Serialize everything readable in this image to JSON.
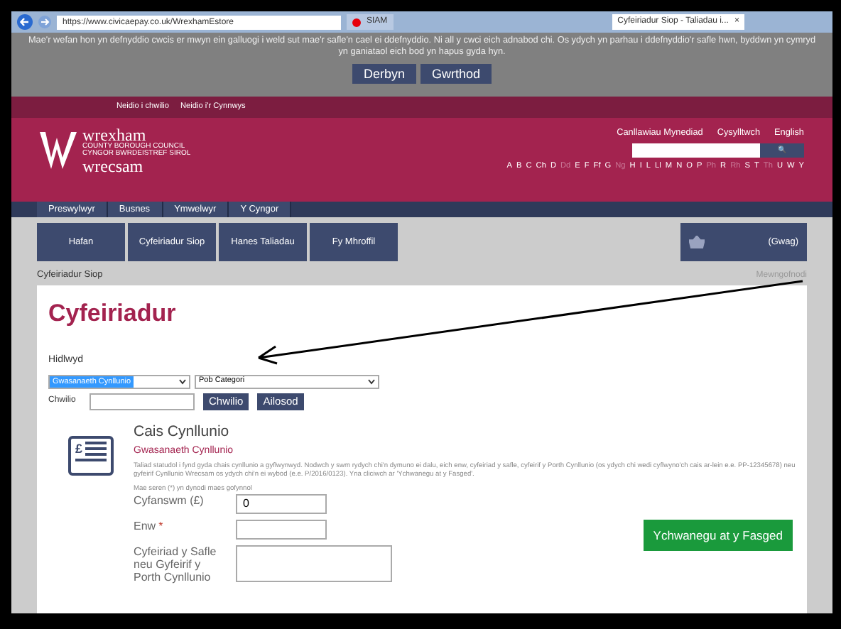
{
  "browser": {
    "url": "https://www.civicaepay.co.uk/WrexhamEstore",
    "tabs": [
      {
        "label": "SIAM",
        "selected": false
      },
      {
        "label": "Cyfeiriadur Siop - Taliadau i...",
        "selected": true
      }
    ],
    "tab_close": "×"
  },
  "cookie_banner": {
    "text": "Mae'r wefan hon yn defnyddio cwcis er mwyn ein galluogi i weld sut mae'r safle'n cael ei ddefnyddio. Ni all y cwci eich adnabod chi. Os ydych yn parhau i ddefnyddio'r safle hwn, byddwn yn cymryd yn ganiataol eich bod yn hapus gyda hyn.",
    "buttons": [
      "Derbyn",
      "Gwrthod"
    ]
  },
  "skip_links": [
    "Neidio i chwilio",
    "Neidio i'r Cynnwys"
  ],
  "logo": {
    "top": "wrexham",
    "top_sub": "COUNTY BOROUGH COUNCIL",
    "bottom_sub": "CYNGOR BWRDEISTREF SIROL",
    "bottom": "wrecsam"
  },
  "header_links": [
    "Canllawiau Mynediad",
    "Cysylltwch",
    "English"
  ],
  "search_button": "🔍",
  "alphabet": [
    {
      "label": "A",
      "disabled": false
    },
    {
      "label": "B",
      "disabled": false
    },
    {
      "label": "C",
      "disabled": false
    },
    {
      "label": "Ch",
      "disabled": false
    },
    {
      "label": "D",
      "disabled": false
    },
    {
      "label": "Dd",
      "disabled": true
    },
    {
      "label": "E",
      "disabled": false
    },
    {
      "label": "F",
      "disabled": false
    },
    {
      "label": "Ff",
      "disabled": false
    },
    {
      "label": "G",
      "disabled": false
    },
    {
      "label": "Ng",
      "disabled": true
    },
    {
      "label": "H",
      "disabled": false
    },
    {
      "label": "I",
      "disabled": false
    },
    {
      "label": "L",
      "disabled": false
    },
    {
      "label": "Ll",
      "disabled": false
    },
    {
      "label": "M",
      "disabled": false
    },
    {
      "label": "N",
      "disabled": false
    },
    {
      "label": "O",
      "disabled": false
    },
    {
      "label": "P",
      "disabled": false
    },
    {
      "label": "Ph",
      "disabled": true
    },
    {
      "label": "R",
      "disabled": false
    },
    {
      "label": "Rh",
      "disabled": true
    },
    {
      "label": "S",
      "disabled": false
    },
    {
      "label": "T",
      "disabled": false
    },
    {
      "label": "Th",
      "disabled": true
    },
    {
      "label": "U",
      "disabled": false
    },
    {
      "label": "W",
      "disabled": false
    },
    {
      "label": "Y",
      "disabled": false
    }
  ],
  "main_nav": [
    "Preswylwyr",
    "Busnes",
    "Ymwelwyr",
    "Y Cyngor"
  ],
  "store_nav": [
    "Hafan",
    "Cyfeiriadur Siop",
    "Hanes Taliadau",
    "Fy Mhroffil"
  ],
  "basket": "(Gwag)",
  "breadcrumb": "Cyfeiriadur Siop",
  "login_link": "Mewngofnodi",
  "page_title": "Cyfeiriadur",
  "filter": {
    "label": "Hidlwyd",
    "service_select": "Gwasanaeth Cynllunio",
    "category_select": "Pob Categori",
    "search_label": "Chwilio",
    "buttons": [
      "Chwilio",
      "Ailosod"
    ]
  },
  "product": {
    "title": "Cais Cynllunio",
    "service": "Gwasanaeth Cynllunio",
    "description": "Taliad statudol i fynd gyda chais cynllunio a gyflwynwyd. Nodwch y swm rydych chi'n dymuno ei dalu, eich enw, cyfeiriad y safle, cyfeirif y Porth Cynllunio (os ydych chi wedi cyflwyno'ch cais ar-lein e.e. PP-12345678) neu gyfeirif Cynllunio Wrecsam os ydych chi'n ei wybod (e.e. P/2016/0123). Yna cliciwch ar 'Ychwanegu at y Fasged'.",
    "required_note": "Mae seren (*) yn dynodi maes gofynnol",
    "icon_symbol": "£",
    "fields": [
      {
        "kind": "input",
        "label": "Cyfanswm (£)",
        "value": "0",
        "required": false
      },
      {
        "kind": "input",
        "label": "Enw",
        "required": true
      },
      {
        "kind": "textarea",
        "label": "Cyfeiriad y Safle neu Gyfeirif y Porth Cynllunio",
        "required": false
      }
    ],
    "required_mark": "*",
    "add_button": "Ychwanegu at y Fasged"
  }
}
